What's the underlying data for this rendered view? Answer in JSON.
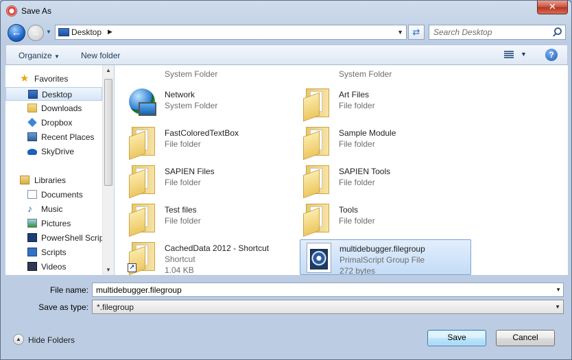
{
  "window": {
    "title": "Save As",
    "close_label": "✕"
  },
  "address": {
    "location": "Desktop"
  },
  "search": {
    "placeholder": "Search Desktop"
  },
  "toolbar": {
    "organize_label": "Organize",
    "new_folder_label": "New folder",
    "help_label": "?"
  },
  "nav": {
    "favorites_label": "Favorites",
    "favorites": [
      {
        "label": "Desktop",
        "icon": "desktop-icon"
      },
      {
        "label": "Downloads",
        "icon": "folder-icon"
      },
      {
        "label": "Dropbox",
        "icon": "dropbox-icon"
      },
      {
        "label": "Recent Places",
        "icon": "recent-places-icon"
      },
      {
        "label": "SkyDrive",
        "icon": "skydrive-icon"
      }
    ],
    "libraries_label": "Libraries",
    "libraries": [
      {
        "label": "Documents",
        "icon": "documents-icon"
      },
      {
        "label": "Music",
        "icon": "music-icon"
      },
      {
        "label": "Pictures",
        "icon": "pictures-icon"
      },
      {
        "label": "PowerShell Script",
        "icon": "powershell-icon"
      },
      {
        "label": "Scripts",
        "icon": "scripts-icon"
      },
      {
        "label": "Videos",
        "icon": "videos-icon"
      }
    ]
  },
  "files": [
    {
      "name": "",
      "type": "System Folder",
      "icon": "user-folder-icon"
    },
    {
      "name": "",
      "type": "System Folder",
      "icon": "computer-icon"
    },
    {
      "name": "Network",
      "type": "System Folder",
      "icon": "network-icon"
    },
    {
      "name": "Art Files",
      "type": "File folder",
      "icon": "folder-icon"
    },
    {
      "name": "FastColoredTextBox",
      "type": "File folder",
      "icon": "folder-icon"
    },
    {
      "name": "Sample Module",
      "type": "File folder",
      "icon": "folder-icon"
    },
    {
      "name": "SAPIEN Files",
      "type": "File folder",
      "icon": "folder-icon"
    },
    {
      "name": "SAPIEN Tools",
      "type": "File folder",
      "icon": "folder-icon"
    },
    {
      "name": "Test files",
      "type": "File folder",
      "icon": "folder-icon"
    },
    {
      "name": "Tools",
      "type": "File folder",
      "icon": "folder-icon"
    },
    {
      "name": "CachedData 2012 - Shortcut",
      "type": "Shortcut",
      "size": "1.04 KB",
      "icon": "folder-shortcut-icon"
    },
    {
      "name": "multidebugger.filegroup",
      "type": "PrimalScript Group File",
      "size": "272 bytes",
      "icon": "filegroup-icon",
      "selected": true
    }
  ],
  "form": {
    "file_name_label": "File name:",
    "file_name_value": "multidebugger.filegroup",
    "save_type_label": "Save as type:",
    "save_type_value": "*.filegroup"
  },
  "footer": {
    "hide_folders_label": "Hide Folders",
    "save_label": "Save",
    "cancel_label": "Cancel"
  },
  "colors": {
    "selection": "#c4dcf7",
    "chrome": "#bccde3",
    "accent": "#1d67c8"
  }
}
